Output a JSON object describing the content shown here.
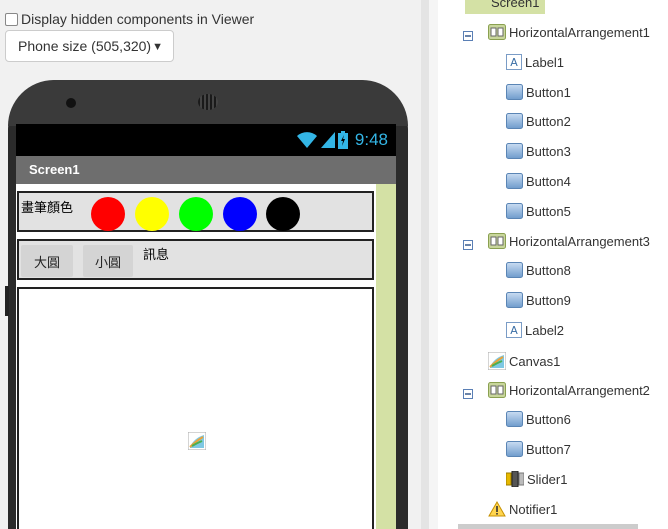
{
  "viewer": {
    "hidden_components_label": "Display hidden components in Viewer",
    "phone_size": "Phone size (505,320)"
  },
  "device": {
    "time": "9:48",
    "screen_title": "Screen1"
  },
  "app": {
    "ha1_label": "畫筆顏色",
    "colors": [
      "#ff0000",
      "#ffff00",
      "#00ff00",
      "#0000ff",
      "#000000"
    ],
    "buttons": [
      "大圓",
      "小圓"
    ],
    "ha3_label": "訊息"
  },
  "tree": {
    "root": "Screen1",
    "items": [
      {
        "name": "HorizontalArrangement1",
        "type": "arrangement",
        "level": 1
      },
      {
        "name": "Label1",
        "type": "label",
        "level": 2
      },
      {
        "name": "Button1",
        "type": "button",
        "level": 2
      },
      {
        "name": "Button2",
        "type": "button",
        "level": 2
      },
      {
        "name": "Button3",
        "type": "button",
        "level": 2
      },
      {
        "name": "Button4",
        "type": "button",
        "level": 2
      },
      {
        "name": "Button5",
        "type": "button",
        "level": 2
      },
      {
        "name": "HorizontalArrangement3",
        "type": "arrangement",
        "level": 1
      },
      {
        "name": "Button8",
        "type": "button",
        "level": 2
      },
      {
        "name": "Button9",
        "type": "button",
        "level": 2
      },
      {
        "name": "Label2",
        "type": "label",
        "level": 2
      },
      {
        "name": "Canvas1",
        "type": "canvas",
        "level": 1
      },
      {
        "name": "HorizontalArrangement2",
        "type": "arrangement",
        "level": 1
      },
      {
        "name": "Button6",
        "type": "button",
        "level": 2
      },
      {
        "name": "Button7",
        "type": "button",
        "level": 2
      },
      {
        "name": "Slider1",
        "type": "slider",
        "level": 2
      },
      {
        "name": "Notifier1",
        "type": "notifier",
        "level": 1
      }
    ]
  }
}
